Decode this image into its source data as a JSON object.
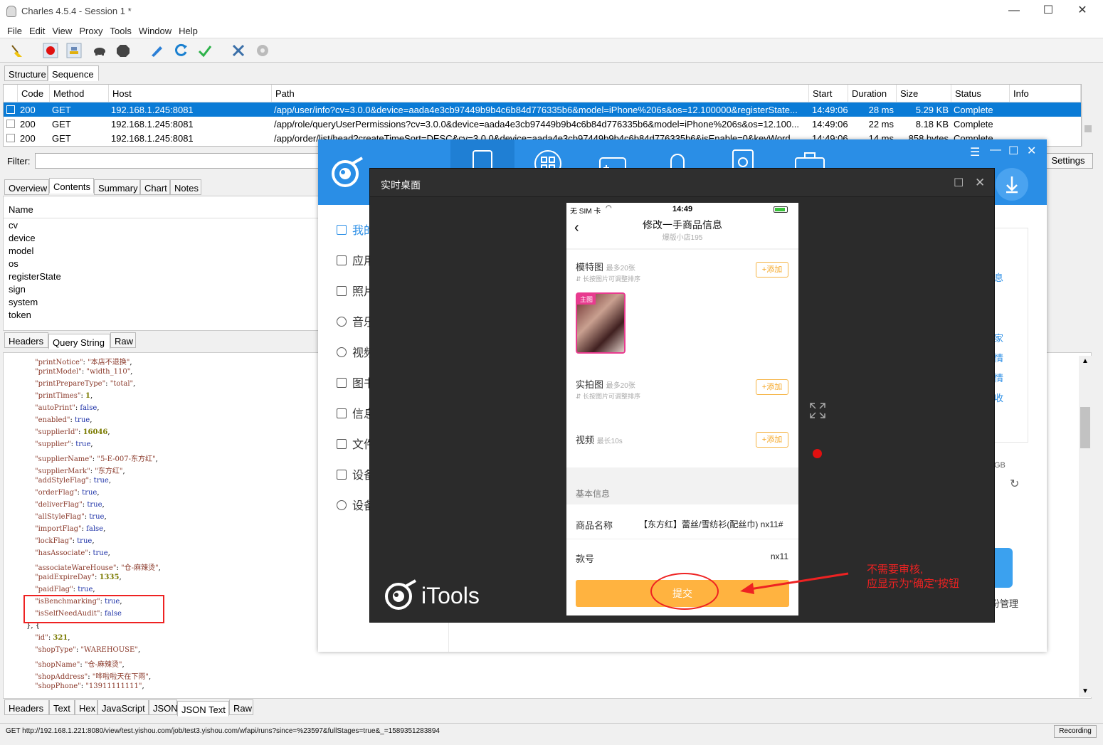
{
  "window": {
    "title": "Charles 4.5.4 - Session 1 *",
    "minimize": "—",
    "maximize": "☐",
    "close": "✕"
  },
  "menu": [
    "File",
    "Edit",
    "View",
    "Proxy",
    "Tools",
    "Window",
    "Help"
  ],
  "view_tabs": [
    "Structure",
    "Sequence"
  ],
  "table": {
    "headers": [
      "Code",
      "Method",
      "Host",
      "Path",
      "Start",
      "Duration",
      "Size",
      "Status",
      "Info"
    ],
    "rows": [
      {
        "code": "200",
        "method": "GET",
        "host": "192.168.1.245:8081",
        "path": "/app/user/info?cv=3.0.0&device=aada4e3cb97449b9b4c6b84d776335b6&model=iPhone%206s&os=12.100000&registerState...",
        "start": "14:49:06",
        "duration": "28 ms",
        "size": "5.29 KB",
        "status": "Complete"
      },
      {
        "code": "200",
        "method": "GET",
        "host": "192.168.1.245:8081",
        "path": "/app/role/queryUserPermissions?cv=3.0.0&device=aada4e3cb97449b9b4c6b84d776335b6&model=iPhone%206s&os=12.100...",
        "start": "14:49:06",
        "duration": "22 ms",
        "size": "8.18 KB",
        "status": "Complete"
      },
      {
        "code": "200",
        "method": "GET",
        "host": "192.168.1.245:8081",
        "path": "/app/order/list/head?createTimeSort=DESC&cv=3.0.0&device=aada4e3cb97449b9b4c6b84d776335b6&isEnable=0&keyWord...",
        "start": "14:49:06",
        "duration": "14 ms",
        "size": "858 bytes",
        "status": "Complete"
      }
    ]
  },
  "filter": {
    "label": "Filter:",
    "settings": "Settings"
  },
  "detail_tabs": [
    "Overview",
    "Contents",
    "Summary",
    "Chart",
    "Notes"
  ],
  "query": {
    "header": "Name",
    "names": [
      "cv",
      "device",
      "model",
      "os",
      "registerState",
      "sign",
      "system",
      "token"
    ]
  },
  "request_tabs": [
    "Headers",
    "Query String",
    "Raw"
  ],
  "response_tabs": [
    "Headers",
    "Text",
    "Hex",
    "JavaScript",
    "JSON",
    "JSON Text",
    "Raw"
  ],
  "json_lines": [
    {
      "indent": 2,
      "key": "\"printNotice\"",
      "val": "\"本店不退换\"",
      "t": "s"
    },
    {
      "indent": 2,
      "key": "\"printModel\"",
      "val": "\"width_110\"",
      "t": "s"
    },
    {
      "indent": 2,
      "key": "\"printPrepareType\"",
      "val": "\"total\"",
      "t": "s"
    },
    {
      "indent": 2,
      "key": "\"printTimes\"",
      "val": "1",
      "t": "n"
    },
    {
      "indent": 2,
      "key": "\"autoPrint\"",
      "val": "false",
      "t": "b"
    },
    {
      "indent": 2,
      "key": "\"enabled\"",
      "val": "true",
      "t": "b"
    },
    {
      "indent": 2,
      "key": "\"supplierId\"",
      "val": "16046",
      "t": "n"
    },
    {
      "indent": 2,
      "key": "\"supplier\"",
      "val": "true",
      "t": "b"
    },
    {
      "indent": 2,
      "key": "\"supplierName\"",
      "val": "\"5-E-007-东方红\"",
      "t": "s"
    },
    {
      "indent": 2,
      "key": "\"supplierMark\"",
      "val": "\"东方红\"",
      "t": "s"
    },
    {
      "indent": 2,
      "key": "\"addStyleFlag\"",
      "val": "true",
      "t": "b"
    },
    {
      "indent": 2,
      "key": "\"orderFlag\"",
      "val": "true",
      "t": "b"
    },
    {
      "indent": 2,
      "key": "\"deliverFlag\"",
      "val": "true",
      "t": "b"
    },
    {
      "indent": 2,
      "key": "\"allStyleFlag\"",
      "val": "true",
      "t": "b"
    },
    {
      "indent": 2,
      "key": "\"importFlag\"",
      "val": "false",
      "t": "b"
    },
    {
      "indent": 2,
      "key": "\"lockFlag\"",
      "val": "true",
      "t": "b"
    },
    {
      "indent": 2,
      "key": "\"hasAssociate\"",
      "val": "true",
      "t": "b"
    },
    {
      "indent": 2,
      "key": "\"associateWareHouse\"",
      "val": "\"仓-麻辣烫\"",
      "t": "s"
    },
    {
      "indent": 2,
      "key": "\"paidExpireDay\"",
      "val": "1335",
      "t": "n"
    },
    {
      "indent": 2,
      "key": "\"paidFlag\"",
      "val": "true",
      "t": "b"
    },
    {
      "indent": 2,
      "key": "\"isBenchmarking\"",
      "val": "true",
      "t": "b"
    },
    {
      "indent": 2,
      "key": "\"isSelfNeedAudit\"",
      "val": "false",
      "t": "b",
      "last": true
    },
    {
      "indent": 1,
      "raw": "}, {"
    },
    {
      "indent": 2,
      "key": "\"id\"",
      "val": "321",
      "t": "n"
    },
    {
      "indent": 2,
      "key": "\"shopType\"",
      "val": "\"WAREHOUSE\"",
      "t": "s"
    },
    {
      "indent": 2,
      "key": "\"shopName\"",
      "val": "\"仓-麻辣烫\"",
      "t": "s"
    },
    {
      "indent": 2,
      "key": "\"shopAddress\"",
      "val": "\"哗啦啦天在下雨\"",
      "t": "s"
    },
    {
      "indent": 2,
      "key": "\"shopPhone\"",
      "val": "\"13911111111\"",
      "t": "s"
    }
  ],
  "statusbar": {
    "url": "GET http://192.168.1.221:8080/view/test.yishou.com/job/test3.yishou.com/wfapi/runs?since=%23597&fullStages=true&_=1589351283894",
    "recording": "Recording"
  },
  "itools": {
    "sidebar": [
      "我的",
      "应用",
      "照片",
      "音乐",
      "视频",
      "图书",
      "信息",
      "文件",
      "设备",
      "设备"
    ],
    "right_fragments": [
      "息",
      "家",
      "情",
      "情",
      "收",
      "GB",
      "份管理"
    ],
    "logo_text": "iTools"
  },
  "rtd": {
    "title": "实时桌面"
  },
  "phone": {
    "carrier": "无 SIM 卡",
    "time": "14:49",
    "nav_title": "修改一手商品信息",
    "nav_sub": "爆版小店195",
    "model_label": "模特图",
    "model_limit": "最多20张",
    "hint": "长按图片可调整排序",
    "main_badge": "主图",
    "add": "+添加",
    "real_label": "实拍图",
    "real_limit": "最多20张",
    "video_label": "视频",
    "video_limit": "最长10s",
    "section_basic": "基本信息",
    "name_label": "商品名称",
    "name_value": "【东方红】蕾丝/雪纺衫(配丝巾) nx11#",
    "code_label": "款号",
    "code_value": "nx11",
    "submit": "提交"
  },
  "annotation": {
    "line1": "不需要审核,",
    "line2": "应显示为“确定”按钮"
  },
  "colors": {
    "charles_select": "#0a7bd6",
    "itools_blue": "#2a8ee6",
    "submit": "#ffb340",
    "annot": "#e22222"
  }
}
